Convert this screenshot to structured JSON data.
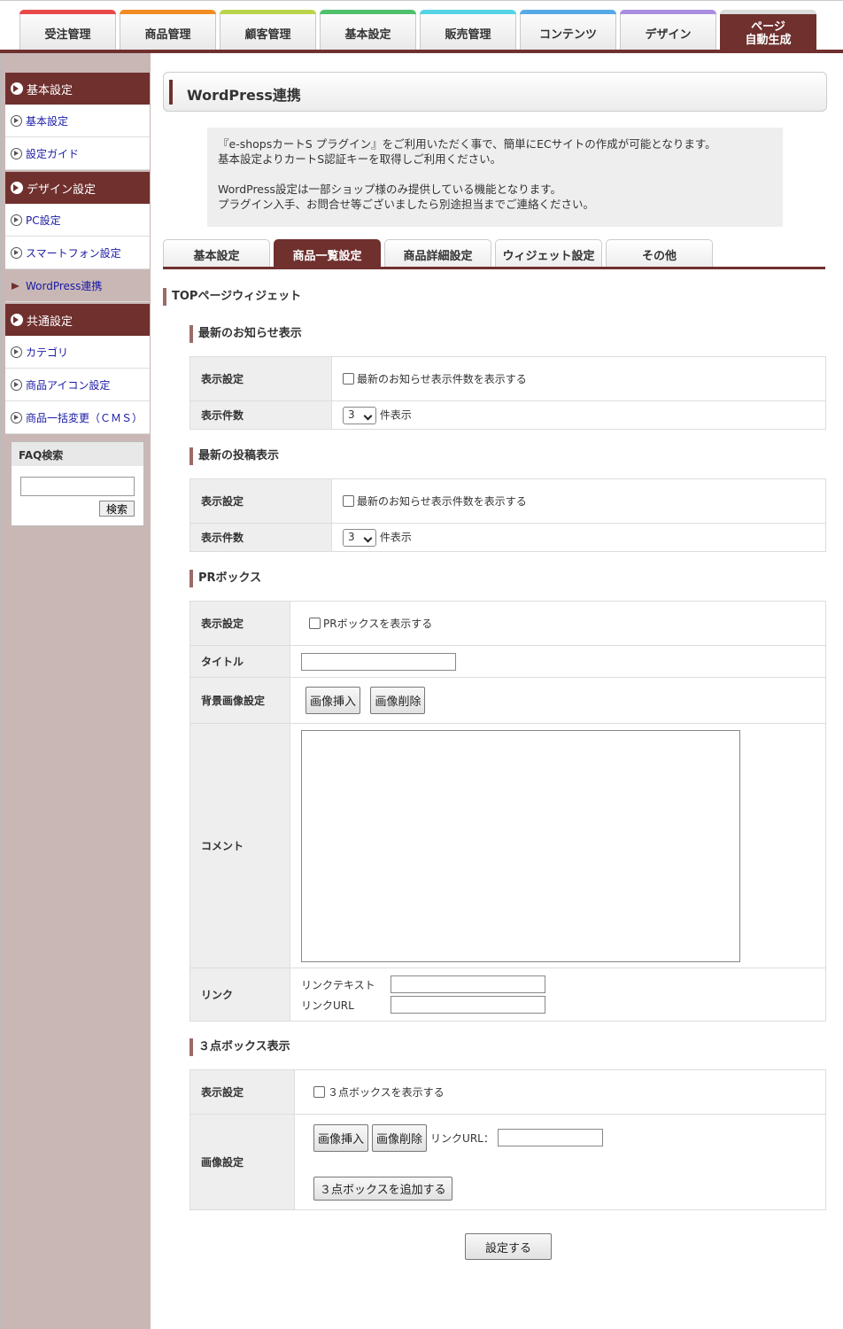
{
  "topnav": {
    "tabs": [
      {
        "label": "受注管理",
        "color": "#e8484a"
      },
      {
        "label": "商品管理",
        "color": "#f08c22"
      },
      {
        "label": "顧客管理",
        "color": "#b9d44a"
      },
      {
        "label": "基本設定",
        "color": "#4fc06c"
      },
      {
        "label": "販売管理",
        "color": "#54d3e4"
      },
      {
        "label": "コンテンツ",
        "color": "#57a9e6"
      },
      {
        "label": "デザイン",
        "color": "#a98de0"
      }
    ],
    "active_tab": {
      "line1": "ページ",
      "line2": "自動生成"
    }
  },
  "sidebar": {
    "section_basic": "基本設定",
    "item_basic": "基本設定",
    "item_guide": "設定ガイド",
    "section_design": "デザイン設定",
    "item_pc": "PC設定",
    "item_sp": "スマートフォン設定",
    "item_wp": "WordPress連携",
    "section_common": "共通設定",
    "item_category": "カテゴリ",
    "item_icon": "商品アイコン設定",
    "item_bulk": "商品一括変更（ＣＭＳ）",
    "faq_title": "FAQ検索",
    "faq_button": "検索"
  },
  "page": {
    "title": "WordPress連携",
    "notice": [
      "『e-shopsカートS プラグイン』をご利用いただく事で、簡単にECサイトの作成が可能となります。",
      "基本設定よりカートS認証キーを取得しご利用ください。",
      "WordPress設定は一部ショップ様のみ提供している機能となります。",
      "プラグイン入手、お問合せ等ございましたら別途担当までご連絡ください。"
    ],
    "tabs": [
      "基本設定",
      "商品一覧設定",
      "商品詳細設定",
      "ウィジェット設定",
      "その他"
    ],
    "section_top": "TOPページウィジェット",
    "news": {
      "heading": "最新のお知らせ表示",
      "display_label": "表示設定",
      "display_checkbox": "最新のお知らせ表示件数を表示する",
      "count_label": "表示件数",
      "count_value": "3",
      "count_unit": "件表示"
    },
    "posts": {
      "heading": "最新の投稿表示",
      "display_label": "表示設定",
      "display_checkbox": "最新のお知らせ表示件数を表示する",
      "count_label": "表示件数",
      "count_value": "3",
      "count_unit": "件表示"
    },
    "pr": {
      "heading": "PRボックス",
      "display_label": "表示設定",
      "display_checkbox": "PRボックスを表示する",
      "title_label": "タイトル",
      "bg_label": "背景画像設定",
      "insert_button": "画像挿入",
      "delete_button": "画像削除",
      "comment_label": "コメント",
      "link_label": "リンク",
      "link_text_label": "リンクテキスト",
      "link_url_label": "リンクURL"
    },
    "three": {
      "heading": "３点ボックス表示",
      "display_label": "表示設定",
      "display_checkbox": "３点ボックスを表示する",
      "image_label": "画像設定",
      "insert_button": "画像挿入",
      "delete_button": "画像削除",
      "link_url_label": "リンクURL：",
      "add_button": "３点ボックスを追加する"
    },
    "submit": "設定する"
  }
}
